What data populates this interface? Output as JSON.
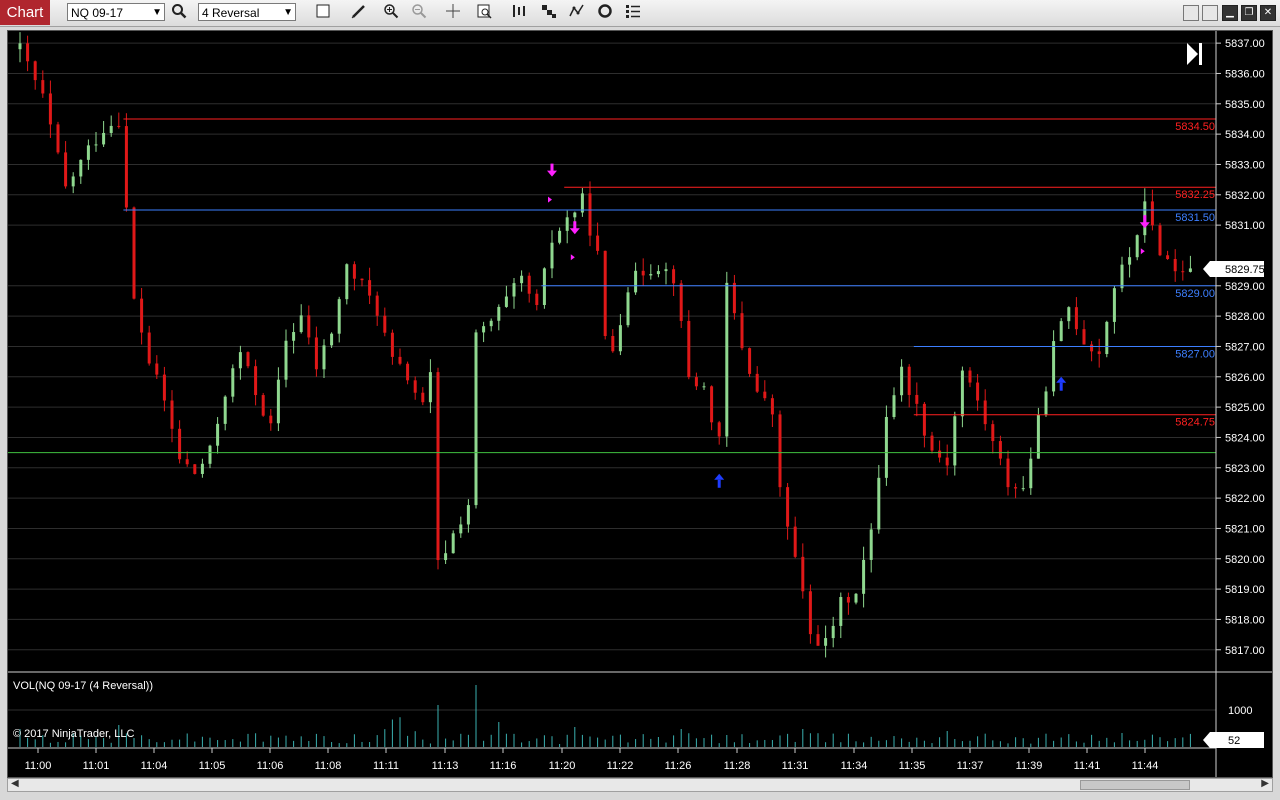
{
  "toolbar": {
    "chart_tab": "Chart",
    "instrument": "NQ 09-17",
    "bar_type": "4 Reversal"
  },
  "price_axis": {
    "ticks": [
      "5837.00",
      "5836.00",
      "5835.00",
      "5834.00",
      "5833.00",
      "5832.00",
      "5831.00",
      "5829.00",
      "5828.00",
      "5827.00",
      "5826.00",
      "5825.00",
      "5824.00",
      "5823.00",
      "5822.00",
      "5821.00",
      "5820.00",
      "5819.00",
      "5818.00",
      "5817.00"
    ],
    "tick_values": [
      5837,
      5836,
      5835,
      5834,
      5833,
      5832,
      5831,
      5829,
      5828,
      5827,
      5826,
      5825,
      5824,
      5823,
      5822,
      5821,
      5820,
      5819,
      5818,
      5817
    ],
    "last_price": "5829.75",
    "last_price_value": 5829.75
  },
  "levels": [
    {
      "label": "5834.50",
      "value": 5834.5,
      "color": "#ff2020",
      "start_bar": 14
    },
    {
      "label": "5832.25",
      "value": 5832.25,
      "color": "#ff2020",
      "start_bar": 72
    },
    {
      "label": "5831.50",
      "value": 5831.5,
      "color": "#3d7fff",
      "start_bar": 14
    },
    {
      "label": "5829.00",
      "value": 5829.0,
      "color": "#3d7fff",
      "start_bar": 69
    },
    {
      "label": "5827.00",
      "value": 5827.0,
      "color": "#3d7fff",
      "start_bar": 118
    },
    {
      "label": "5824.75",
      "value": 5824.75,
      "color": "#ff2020",
      "start_bar": 118
    }
  ],
  "support_line": {
    "value": 5823.5,
    "color": "#40c040"
  },
  "time_axis": [
    "11:00",
    "11:01",
    "11:04",
    "11:05",
    "11:06",
    "11:08",
    "11:11",
    "11:13",
    "11:16",
    "11:20",
    "11:22",
    "11:26",
    "11:28",
    "11:31",
    "11:34",
    "11:35",
    "11:37",
    "11:39",
    "11:41",
    "11:44"
  ],
  "volume_panel": {
    "title": "VOL(NQ 09-17 (4 Reversal))",
    "axis_label": "1000",
    "axis_value": 1000,
    "current": "52",
    "current_value": 52,
    "copyright": "© 2017 NinjaTrader, LLC"
  },
  "colors": {
    "up": "#8fd88f",
    "down": "#e01818",
    "volume": "#3ab0b0",
    "grid": "#2e2e2e"
  },
  "chart_data": {
    "type": "candlestick",
    "instrument": "NQ 09-17",
    "bar_type": "4 Reversal",
    "ylim": [
      5816.3,
      5837.4
    ],
    "price_knots": [
      [
        0,
        5836.8
      ],
      [
        3,
        5835.2
      ],
      [
        6,
        5832.2
      ],
      [
        9,
        5833.5
      ],
      [
        11,
        5834.2
      ],
      [
        13,
        5834.5
      ],
      [
        15,
        5828.5
      ],
      [
        17,
        5826.5
      ],
      [
        19,
        5825.2
      ],
      [
        21,
        5823.3
      ],
      [
        23,
        5822.8
      ],
      [
        25,
        5823.5
      ],
      [
        27,
        5825.5
      ],
      [
        29,
        5826.8
      ],
      [
        31,
        5825.5
      ],
      [
        33,
        5824.3
      ],
      [
        35,
        5827.2
      ],
      [
        37,
        5828.0
      ],
      [
        39,
        5826.3
      ],
      [
        41,
        5827.5
      ],
      [
        43,
        5829.6
      ],
      [
        45,
        5829.0
      ],
      [
        47,
        5828.2
      ],
      [
        49,
        5826.5
      ],
      [
        51,
        5826.0
      ],
      [
        53,
        5825.0
      ],
      [
        54,
        5826.0
      ],
      [
        55,
        5819.8
      ],
      [
        57,
        5820.8
      ],
      [
        59,
        5821.8
      ],
      [
        60,
        5827.3
      ],
      [
        62,
        5827.8
      ],
      [
        64,
        5828.5
      ],
      [
        66,
        5829.2
      ],
      [
        68,
        5828.2
      ],
      [
        70,
        5830.5
      ],
      [
        72,
        5831.2
      ],
      [
        74,
        5831.8
      ],
      [
        76,
        5830.0
      ],
      [
        77,
        5827.2
      ],
      [
        78,
        5826.9
      ],
      [
        80,
        5829.0
      ],
      [
        82,
        5829.5
      ],
      [
        84,
        5829.7
      ],
      [
        86,
        5829.3
      ],
      [
        88,
        5826.0
      ],
      [
        90,
        5825.6
      ],
      [
        92,
        5823.8
      ],
      [
        93,
        5829.0
      ],
      [
        95,
        5827.0
      ],
      [
        97,
        5825.5
      ],
      [
        99,
        5824.8
      ],
      [
        100,
        5822.2
      ],
      [
        102,
        5820.0
      ],
      [
        104,
        5817.5
      ],
      [
        106,
        5817.2
      ],
      [
        108,
        5818.5
      ],
      [
        110,
        5819.0
      ],
      [
        112,
        5820.8
      ],
      [
        114,
        5824.8
      ],
      [
        116,
        5826.2
      ],
      [
        118,
        5825.0
      ],
      [
        120,
        5823.6
      ],
      [
        122,
        5823.2
      ],
      [
        124,
        5826.2
      ],
      [
        126,
        5825.2
      ],
      [
        128,
        5823.8
      ],
      [
        130,
        5822.5
      ],
      [
        132,
        5822.3
      ],
      [
        134,
        5824.5
      ],
      [
        136,
        5827.0
      ],
      [
        138,
        5828.3
      ],
      [
        140,
        5827.2
      ],
      [
        142,
        5826.8
      ],
      [
        144,
        5829.0
      ],
      [
        146,
        5830.0
      ],
      [
        148,
        5831.6
      ],
      [
        150,
        5830.2
      ],
      [
        152,
        5829.5
      ],
      [
        154,
        5829.7
      ]
    ],
    "bar_count": 155,
    "signals_down": [
      {
        "bar": 70,
        "price": 5832.5
      },
      {
        "bar": 73,
        "price": 5830.6
      },
      {
        "bar": 148,
        "price": 5830.8
      }
    ],
    "signals_up": [
      {
        "bar": 92,
        "price": 5823.0
      },
      {
        "bar": 137,
        "price": 5826.2
      }
    ]
  }
}
